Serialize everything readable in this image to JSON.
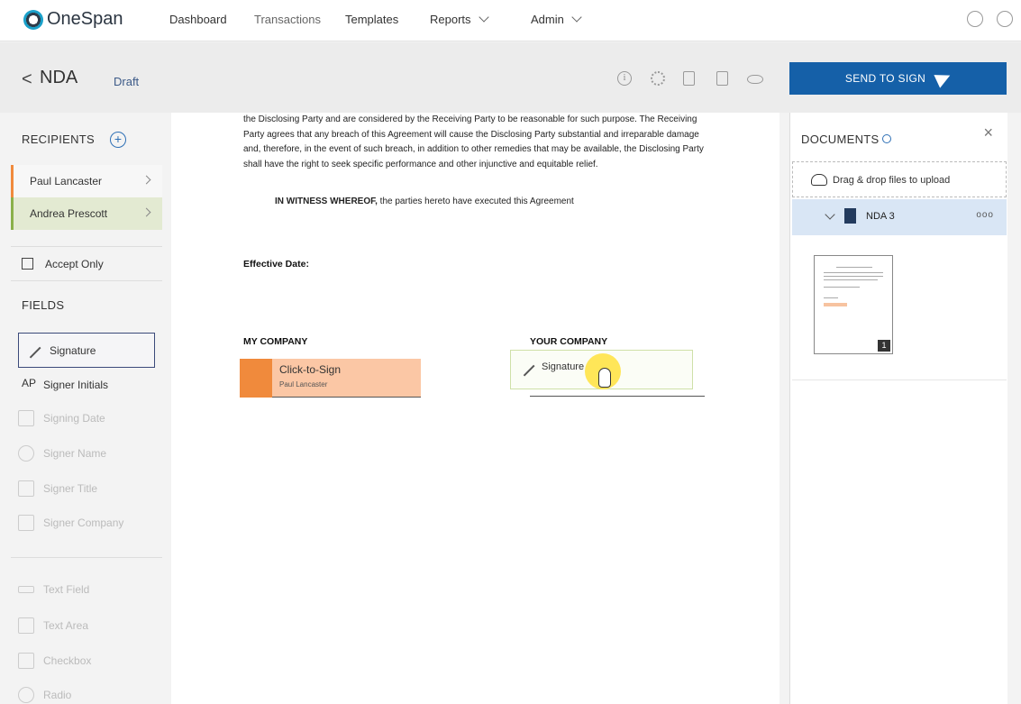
{
  "app": {
    "logo_text": "OneSpan"
  },
  "nav": {
    "items": [
      {
        "label": "Dashboard"
      },
      {
        "label": "Transactions"
      },
      {
        "label": "Templates"
      },
      {
        "label": "Reports"
      },
      {
        "label": "Admin"
      }
    ]
  },
  "titlebar": {
    "back_glyph": "<",
    "title": "NDA",
    "status": "Draft",
    "send_label": "SEND TO SIGN",
    "info_glyph": "i"
  },
  "sidebar": {
    "recipients_heading": "RECIPIENTS",
    "add_glyph": "+",
    "recipients": [
      {
        "name": "Paul Lancaster",
        "color": "#f08a3c"
      },
      {
        "name": "Andrea Prescott",
        "color": "#8ab04a"
      }
    ],
    "accept_only_label": "Accept Only",
    "fields_heading": "FIELDS",
    "fields": [
      {
        "label": "Signature",
        "icon": "pen-icon",
        "enabled": true
      },
      {
        "label": "Signer Initials",
        "prefix": "AP",
        "enabled": true
      },
      {
        "label": "Signing Date",
        "icon": "calendar-icon",
        "enabled": false
      },
      {
        "label": "Signer Name",
        "icon": "person-icon",
        "enabled": false
      },
      {
        "label": "Signer Title",
        "icon": "id-card-icon",
        "enabled": false
      },
      {
        "label": "Signer Company",
        "icon": "building-icon",
        "enabled": false
      },
      {
        "label": "Text Field",
        "icon": "text-field-icon",
        "enabled": false
      },
      {
        "label": "Text Area",
        "icon": "text-area-icon",
        "enabled": false
      },
      {
        "label": "Checkbox",
        "icon": "checkbox-icon",
        "enabled": false
      },
      {
        "label": "Radio",
        "icon": "radio-icon",
        "enabled": false
      }
    ]
  },
  "document": {
    "body_text": "the Disclosing Party and are considered by the Receiving Party to be reasonable for such purpose. The Receiving Party agrees that any breach of this Agreement will cause the Disclosing Party substantial and irreparable damage and, therefore, in the event of such breach, in addition to other remedies that may be available, the Disclosing Party shall have the right to seek specific performance and other injunctive and equitable relief.",
    "witness_bold": "IN WITNESS WHEREOF,",
    "witness_rest": " the parties hereto have executed this Agreement",
    "effective_date_label": "Effective Date:",
    "my_company_label": "MY COMPANY",
    "your_company_label": "YOUR COMPANY",
    "click_to_sign_label": "Click-to-Sign",
    "click_to_sign_signer": "Paul Lancaster",
    "signature_drop_label": "Signature"
  },
  "documents_panel": {
    "heading": "DOCUMENTS",
    "close_glyph": "×",
    "upload_label": "Drag & drop files to upload",
    "doc_name": "NDA 3",
    "more_glyph": "ooo",
    "page_number": "1"
  },
  "colors": {
    "primary": "#1560a8",
    "recipient1": "#f08a3c",
    "recipient2": "#8ab04a"
  }
}
